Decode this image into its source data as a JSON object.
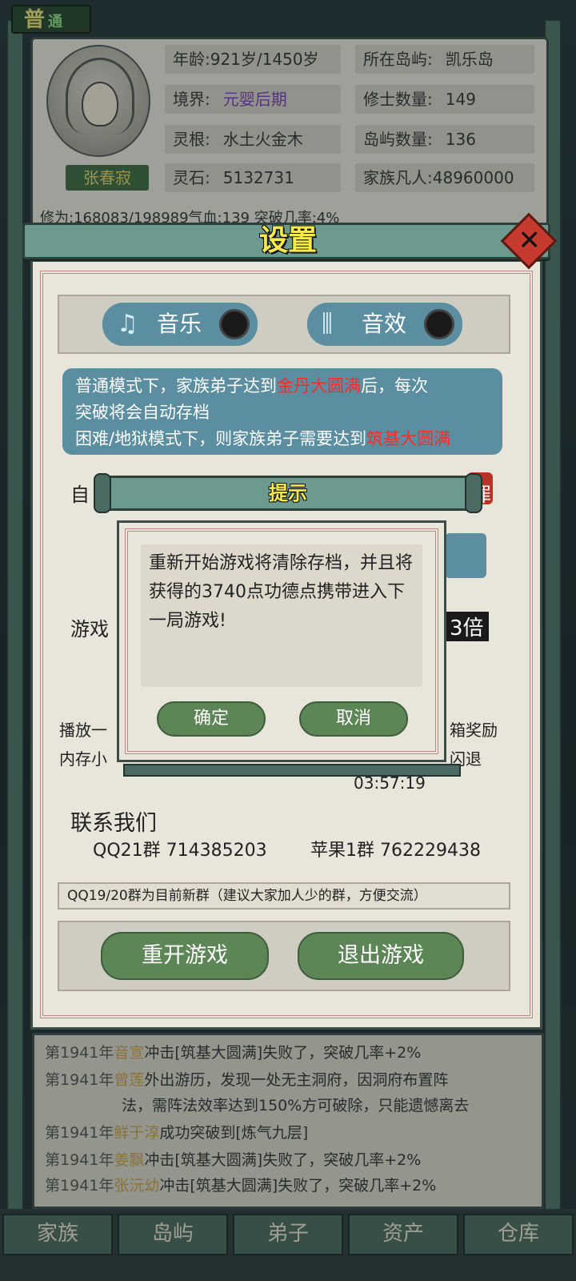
{
  "mode": {
    "label": "普",
    "sub": "通"
  },
  "character": {
    "name": "张春寂",
    "stats": [
      {
        "label": "年龄:921岁/1450岁",
        "value": ""
      },
      {
        "label": "所在岛屿:",
        "value": "凯乐岛"
      },
      {
        "label": "境界:",
        "value": "元婴后期"
      },
      {
        "label": "修士数量:",
        "value": "149"
      },
      {
        "label": "灵根:",
        "value": "水土火金木"
      },
      {
        "label": "岛屿数量:",
        "value": "136"
      },
      {
        "label": "灵石:",
        "value": "5132731"
      },
      {
        "label": "家族凡人:",
        "value": "48960000"
      }
    ],
    "peek_row": "修为:168083/198989气血:139  突破几率:4%"
  },
  "settings": {
    "title": "设置",
    "close_icon": "close-x-icon",
    "music_label": "音乐",
    "sound_label": "音效",
    "notice_line1_a": "普通模式下，家族弟子达到",
    "notice_line1_red": "金丹大圆满",
    "notice_line1_b": "后，每次",
    "notice_line2": "突破将会自动存档",
    "notice_line3_a": "困难/地狱模式下，则家族弟子需要达到",
    "notice_line3_red": "筑基大圆满",
    "partial_auto": "自",
    "partial_auto_r": "罪",
    "partial_game": "游戏",
    "partial_speed": "3倍",
    "partial_play": "播放一",
    "partial_reward": "箱奖励",
    "partial_memory": "内存小",
    "partial_crash": "闪退",
    "timer": "03:57:19",
    "contact_title": "联系我们",
    "qq_group": "QQ21群  714385203",
    "apple_group": "苹果1群 762229438",
    "group_note": "QQ19/20群为目前新群（建议大家加人少的群，方便交流）",
    "restart_label": "重开游戏",
    "exit_label": "退出游戏"
  },
  "tip": {
    "title": "提示",
    "message": "重新开始游戏将清除存档，并且将获得的3740点功德点携带进入下一局游戏!",
    "confirm_label": "确定",
    "cancel_label": "取消"
  },
  "log": [
    {
      "year": "第1941年",
      "name": "音宣",
      "text": "冲击[筑基大圆满]失败了，突破几率+2%"
    },
    {
      "year": "第1941年",
      "name": "曾莲",
      "text": "外出游历，发现一处无主洞府，因洞府布置阵"
    },
    {
      "year": "",
      "name": "",
      "text": "法，需阵法效率达到150%方可破除，只能遗憾离去"
    },
    {
      "year": "第1941年",
      "name": "鲜于淳",
      "text": "成功突破到[炼气九层]"
    },
    {
      "year": "第1941年",
      "name": "姜飘",
      "text": "冲击[筑基大圆满]失败了，突破几率+2%"
    },
    {
      "year": "第1941年",
      "name": "张沅幼",
      "text": "冲击[筑基大圆满]失败了，突破几率+2%"
    }
  ],
  "nav": [
    "家族",
    "岛屿",
    "弟子",
    "资产",
    "仓库"
  ]
}
